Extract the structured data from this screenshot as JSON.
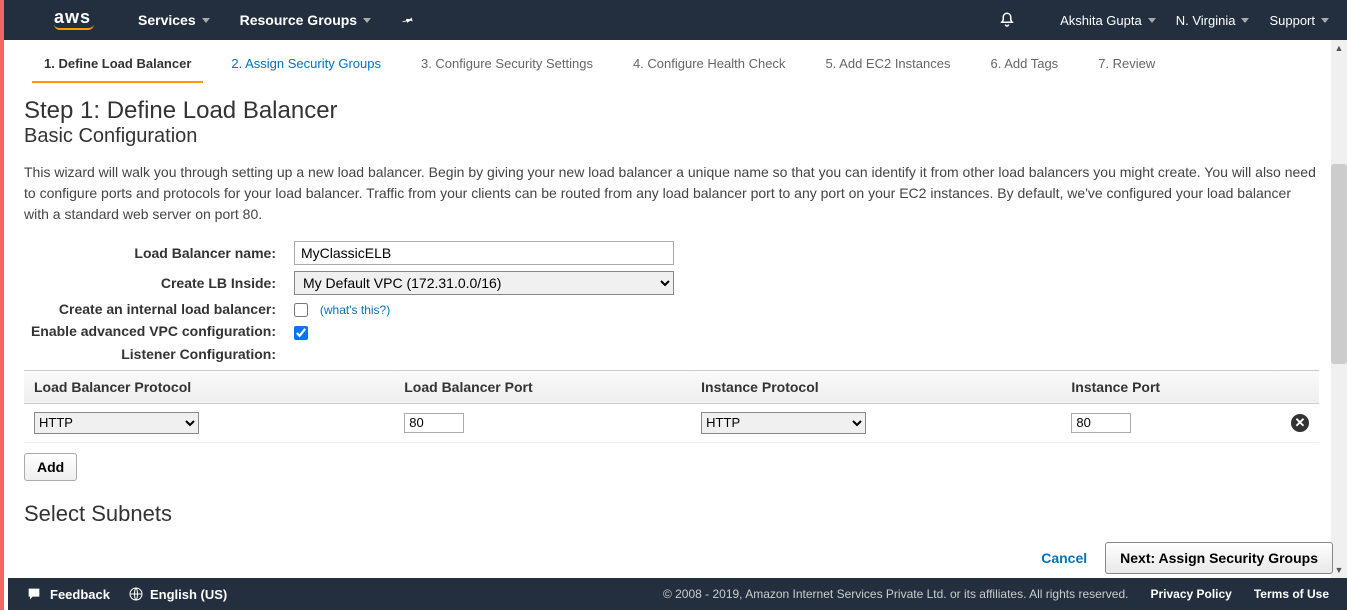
{
  "nav": {
    "logo": "aws",
    "services": "Services",
    "resource_groups": "Resource Groups",
    "user": "Akshita Gupta",
    "region": "N. Virginia",
    "support": "Support"
  },
  "steps": [
    {
      "label": "1. Define Load Balancer",
      "state": "active"
    },
    {
      "label": "2. Assign Security Groups",
      "state": "next"
    },
    {
      "label": "3. Configure Security Settings",
      "state": ""
    },
    {
      "label": "4. Configure Health Check",
      "state": ""
    },
    {
      "label": "5. Add EC2 Instances",
      "state": ""
    },
    {
      "label": "6. Add Tags",
      "state": ""
    },
    {
      "label": "7. Review",
      "state": ""
    }
  ],
  "page": {
    "title": "Step 1: Define Load Balancer",
    "subtitle": "Basic Configuration",
    "description": "This wizard will walk you through setting up a new load balancer. Begin by giving your new load balancer a unique name so that you can identify it from other load balancers you might create. You will also need to configure ports and protocols for your load balancer. Traffic from your clients can be routed from any load balancer port to any port on your EC2 instances. By default, we've configured your load balancer with a standard web server on port 80."
  },
  "form": {
    "lb_name_label": "Load Balancer name:",
    "lb_name_value": "MyClassicELB",
    "create_inside_label": "Create LB Inside:",
    "create_inside_value": "My Default VPC (172.31.0.0/16)",
    "internal_label": "Create an internal load balancer:",
    "internal_checked": false,
    "whats_this": "(what's this?)",
    "adv_vpc_label": "Enable advanced VPC configuration:",
    "adv_vpc_checked": true,
    "listener_label": "Listener Configuration:"
  },
  "listener_table": {
    "headers": [
      "Load Balancer Protocol",
      "Load Balancer Port",
      "Instance Protocol",
      "Instance Port"
    ],
    "rows": [
      {
        "lb_protocol": "HTTP",
        "lb_port": "80",
        "inst_protocol": "HTTP",
        "inst_port": "80"
      }
    ],
    "add_label": "Add"
  },
  "subnets_title": "Select Subnets",
  "actions": {
    "cancel": "Cancel",
    "next": "Next: Assign Security Groups"
  },
  "footer": {
    "feedback": "Feedback",
    "language": "English (US)",
    "copyright": "© 2008 - 2019, Amazon Internet Services Private Ltd. or its affiliates. All rights reserved.",
    "privacy": "Privacy Policy",
    "terms": "Terms of Use"
  }
}
